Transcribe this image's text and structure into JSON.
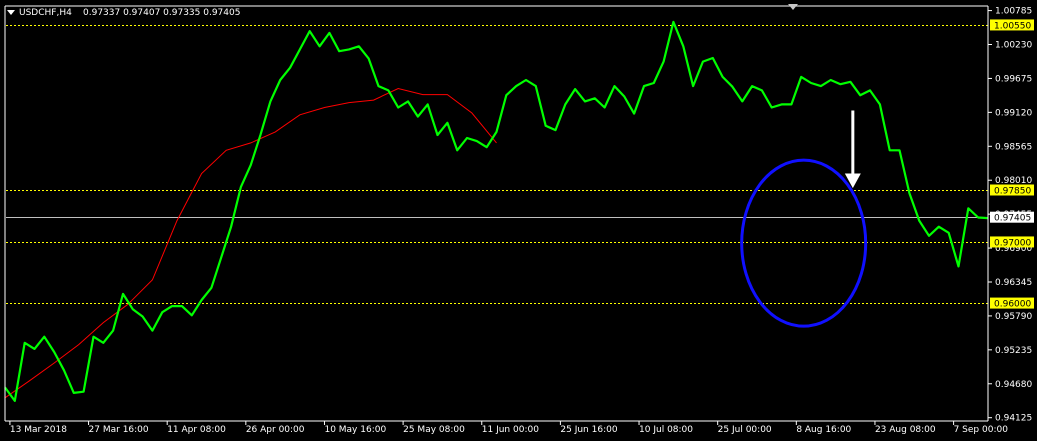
{
  "header": {
    "symbol": "USDCHF,H4",
    "quote": "0.97337 0.97407 0.97335 0.97405"
  },
  "colors": {
    "background": "#000000",
    "price": "#00ff00",
    "ma": "#ff0000",
    "level_line": "#ffff00",
    "level_box": "#ffff00",
    "ellipse": "#1010ff",
    "arrow": "#ffffff",
    "axis": "#ffffff"
  },
  "chart_data": {
    "type": "line",
    "instrument": "USDCHF",
    "timeframe": "H4",
    "ylim": [
      0.9412,
      1.0086
    ],
    "y_ticks": [
      "1.00785",
      "1.00230",
      "0.99675",
      "0.99120",
      "0.98565",
      "0.98010",
      "0.97455",
      "0.96900",
      "0.96345",
      "0.95790",
      "0.95235",
      "0.94680",
      "0.94125"
    ],
    "x_ticks": [
      "13 Mar 2018",
      "27 Mar 16:00",
      "11 Apr 08:00",
      "26 Apr 00:00",
      "10 May 16:00",
      "25 May 08:00",
      "11 Jun 00:00",
      "25 Jun 16:00",
      "10 Jul 08:00",
      "25 Jul 00:00",
      "8 Aug 16:00",
      "23 Aug 08:00",
      "7 Sep 00:00"
    ],
    "levels": [
      {
        "value": "1.00550",
        "price": 1.0055
      },
      {
        "value": "0.97850",
        "price": 0.9785
      },
      {
        "value": "0.97000",
        "price": 0.97
      },
      {
        "value": "0.96000",
        "price": 0.96
      }
    ],
    "current": {
      "value": "0.97405",
      "price": 0.97405
    },
    "series": [
      {
        "kind": "price",
        "x": [
          0,
          2,
          4,
          6,
          8,
          10,
          12,
          14,
          16,
          18,
          20,
          22,
          24,
          26,
          28,
          30,
          32,
          34,
          36,
          38,
          40,
          42,
          44,
          46,
          48,
          50,
          52,
          54,
          56,
          58,
          60,
          62,
          64,
          66,
          68,
          70,
          72,
          74,
          76,
          78,
          80,
          82,
          84,
          86,
          88,
          90,
          92,
          94,
          96,
          98,
          100,
          102,
          104,
          106,
          108,
          110,
          112,
          114,
          116,
          118,
          120,
          122,
          124,
          126,
          128,
          130,
          132,
          134,
          136,
          138,
          140,
          142,
          144,
          146,
          148,
          150,
          152,
          154,
          156,
          158,
          160,
          162,
          164,
          166,
          168,
          170,
          172,
          174,
          176,
          178,
          180,
          182,
          184,
          186,
          188,
          190,
          192,
          194,
          196,
          198,
          200
        ],
        "values": [
          0.9462,
          0.944,
          0.9535,
          0.9525,
          0.9545,
          0.952,
          0.949,
          0.9453,
          0.9455,
          0.9545,
          0.9535,
          0.9555,
          0.9615,
          0.959,
          0.9578,
          0.9555,
          0.9585,
          0.9595,
          0.9595,
          0.958,
          0.9605,
          0.9625,
          0.9675,
          0.9725,
          0.979,
          0.9826,
          0.9876,
          0.993,
          0.9965,
          0.9985,
          1.0015,
          1.0045,
          1.002,
          1.0042,
          1.0012,
          1.0015,
          1.002,
          1.0,
          0.9955,
          0.9948,
          0.992,
          0.993,
          0.9905,
          0.9925,
          0.9875,
          0.9895,
          0.985,
          0.987,
          0.9865,
          0.9855,
          0.988,
          0.994,
          0.9955,
          0.9965,
          0.9955,
          0.989,
          0.9883,
          0.9925,
          0.995,
          0.993,
          0.9935,
          0.992,
          0.9955,
          0.9938,
          0.991,
          0.9955,
          0.996,
          0.9995,
          1.006,
          1.002,
          0.9955,
          0.9995,
          1.0001,
          0.997,
          0.9954,
          0.993,
          0.9955,
          0.9948,
          0.992,
          0.9925,
          0.9925,
          0.997,
          0.996,
          0.9955,
          0.9965,
          0.9958,
          0.9962,
          0.994,
          0.9948,
          0.9925,
          0.985,
          0.985,
          0.978,
          0.9735,
          0.971,
          0.9725,
          0.9715,
          0.966,
          0.9755,
          0.974,
          0.9739
        ]
      },
      {
        "kind": "moving-average",
        "x": [
          0,
          5,
          10,
          15,
          20,
          25,
          30,
          35,
          40,
          45,
          50,
          55,
          60,
          65,
          70,
          75,
          80,
          85,
          90,
          95,
          100
        ],
        "values": [
          0.9445,
          0.9473,
          0.9502,
          0.9532,
          0.9568,
          0.9598,
          0.9638,
          0.9735,
          0.9812,
          0.985,
          0.9862,
          0.988,
          0.9908,
          0.992,
          0.9928,
          0.9932,
          0.9951,
          0.9941,
          0.9941,
          0.9911,
          0.9862
        ]
      }
    ],
    "x_range": [
      0,
      200
    ]
  }
}
